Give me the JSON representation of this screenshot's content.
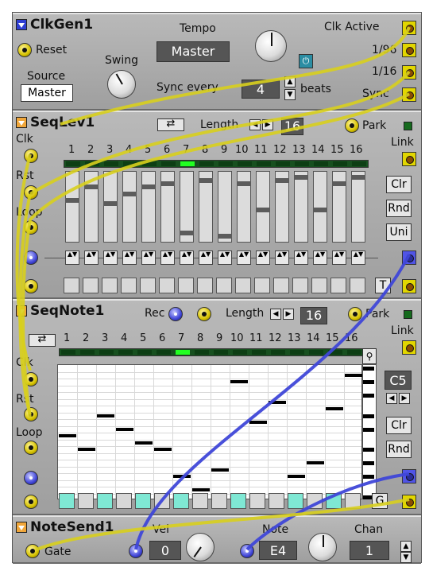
{
  "clkgen": {
    "title": "ClkGen1",
    "reset_label": "Reset",
    "tempo_label": "Tempo",
    "tempo_value": "Master",
    "swing_label": "Swing",
    "source_label": "Source",
    "source_value": "Master",
    "sync_label": "Sync every",
    "sync_value": "4",
    "beats_label": "beats",
    "clk_active_label": "Clk Active",
    "out_1_96": "1/96",
    "out_1_16": "1/16",
    "sync_out": "Sync",
    "power_icon": "power-icon"
  },
  "seqlev": {
    "title": "SeqLev1",
    "length_label": "Length",
    "length_value": "16",
    "park_label": "Park",
    "link_label": "Link",
    "clk_label": "Clk",
    "rst_label": "Rst",
    "loop_label": "Loop",
    "steps": [
      "1",
      "2",
      "3",
      "4",
      "5",
      "6",
      "7",
      "8",
      "9",
      "10",
      "11",
      "12",
      "13",
      "14",
      "15",
      "16"
    ],
    "active_step": 7,
    "levels": [
      0.6,
      0.8,
      0.55,
      0.7,
      0.8,
      0.85,
      0.1,
      0.9,
      0.05,
      0.85,
      0.45,
      0.9,
      0.95,
      0.45,
      0.85,
      0.95
    ],
    "clr": "Clr",
    "rnd": "Rnd",
    "uni": "Uni",
    "t_button": "T"
  },
  "seqnote": {
    "title": "SeqNote1",
    "rec_label": "Rec",
    "length_label": "Length",
    "length_value": "16",
    "park_label": "Park",
    "link_label": "Link",
    "clk_label": "Clk",
    "rst_label": "Rst",
    "loop_label": "Loop",
    "steps": [
      "1",
      "2",
      "3",
      "4",
      "5",
      "6",
      "7",
      "8",
      "9",
      "10",
      "11",
      "12",
      "13",
      "14",
      "15",
      "16"
    ],
    "active_step": 7,
    "notes": [
      9,
      7,
      12,
      10,
      8,
      7,
      3,
      1,
      4,
      17,
      11,
      14,
      3,
      5,
      13,
      18
    ],
    "gates": [
      1,
      0,
      1,
      0,
      1,
      0,
      1,
      0,
      0,
      1,
      0,
      0,
      1,
      0,
      1,
      0
    ],
    "octave_value": "C5",
    "clr": "Clr",
    "rnd": "Rnd",
    "g_button": "G"
  },
  "notesend": {
    "title": "NoteSend1",
    "gate_label": "Gate",
    "vel_label": "Vel",
    "vel_value": "0",
    "note_label": "Note",
    "note_value": "E4",
    "chan_label": "Chan",
    "chan_value": "1"
  },
  "colors": {
    "cable_yellow": "#d8cf1d",
    "cable_blue": "#3f47d8",
    "panel": "#a7a7a7",
    "led_on": "#22ff22",
    "gate_on": "#7fe8d4"
  }
}
